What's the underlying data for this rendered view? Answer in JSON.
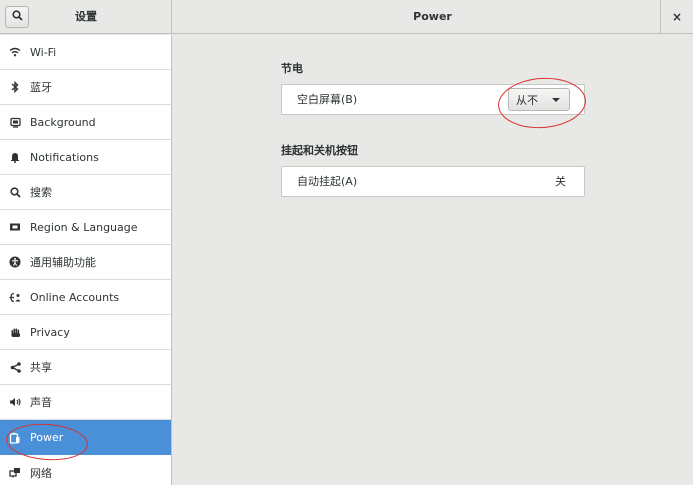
{
  "window": {
    "sidebar_title": "设置",
    "main_title": "Power",
    "close_glyph": "×"
  },
  "sidebar": {
    "items": [
      {
        "label": "Wi-Fi",
        "icon": "wifi-icon"
      },
      {
        "label": "蓝牙",
        "icon": "bluetooth-icon"
      },
      {
        "label": "Background",
        "icon": "background-icon"
      },
      {
        "label": "Notifications",
        "icon": "bell-icon"
      },
      {
        "label": "搜索",
        "icon": "search-icon"
      },
      {
        "label": "Region & Language",
        "icon": "flag-icon"
      },
      {
        "label": "通用辅助功能",
        "icon": "accessibility-icon"
      },
      {
        "label": "Online Accounts",
        "icon": "online-accounts-icon"
      },
      {
        "label": "Privacy",
        "icon": "hand-icon"
      },
      {
        "label": "共享",
        "icon": "share-icon"
      },
      {
        "label": "声音",
        "icon": "speaker-icon"
      },
      {
        "label": "Power",
        "icon": "power-icon",
        "active": true
      },
      {
        "label": "网络",
        "icon": "network-icon"
      }
    ]
  },
  "power": {
    "saving": {
      "title": "节电",
      "blank_screen_label": "空白屏幕(B)",
      "blank_screen_value": "从不"
    },
    "suspend": {
      "title": "挂起和关机按钮",
      "auto_suspend_label": "自动挂起(A)",
      "auto_suspend_value": "关"
    }
  },
  "colors": {
    "accent": "#4a90d9",
    "annotation": "#d9302c"
  }
}
